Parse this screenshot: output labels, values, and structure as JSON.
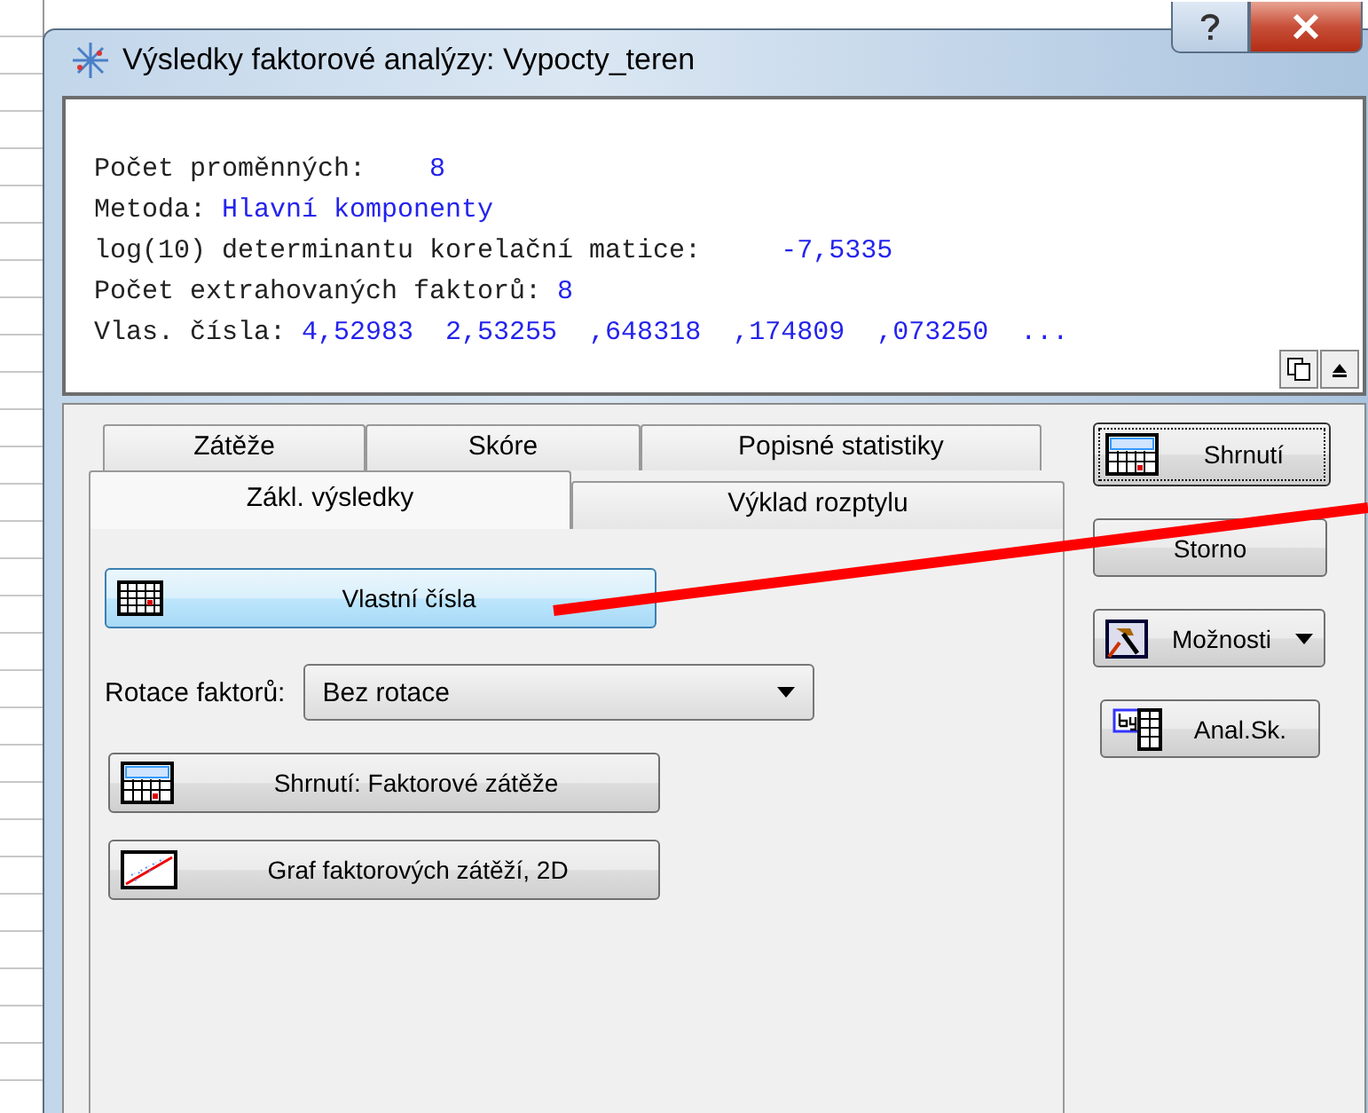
{
  "window": {
    "title": "Výsledky faktorové analýzy: Vypocty_teren"
  },
  "output": {
    "lines": [
      {
        "label": "Počet proměnných:    ",
        "value": "8"
      },
      {
        "label": "Metoda: ",
        "value": "Hlavní komponenty"
      },
      {
        "label": "log(10) determinantu korelační matice:     ",
        "value": "-7,5335"
      },
      {
        "label": "Počet extrahovaných faktorů: ",
        "value": "8"
      },
      {
        "label": "Vlas. čísla: ",
        "value": "4,52983  2,53255  ,648318  ,174809  ,073250  ..."
      }
    ]
  },
  "tabs_back": [
    {
      "label": "Zátěže",
      "selected": false
    },
    {
      "label": "Skóre",
      "selected": false
    },
    {
      "label": "Popisné statistiky",
      "selected": false
    }
  ],
  "tabs_front": [
    {
      "label": "Zákl. výsledky",
      "selected": true
    },
    {
      "label": "Výklad rozptylu",
      "selected": false
    }
  ],
  "panel": {
    "buttons": [
      {
        "label": "Vlastní čísla",
        "kind": "grid",
        "focused": true
      }
    ],
    "rotation": {
      "label": "Rotace faktorů:",
      "value": "Bez rotace"
    },
    "more_buttons": [
      {
        "label": "Shrnutí: Faktorové zátěže",
        "kind": "summary",
        "focused": false
      },
      {
        "label": "Graf faktorových zátěží, 2D",
        "kind": "plot",
        "focused": false
      }
    ]
  },
  "side_buttons": [
    {
      "label": "Shrnutí",
      "kind": "summary"
    },
    {
      "label": "Storno",
      "kind": "cancel"
    },
    {
      "label": "Možnosti",
      "kind": "options"
    },
    {
      "label": "Anal.Sk.",
      "kind": "bygroup"
    }
  ]
}
